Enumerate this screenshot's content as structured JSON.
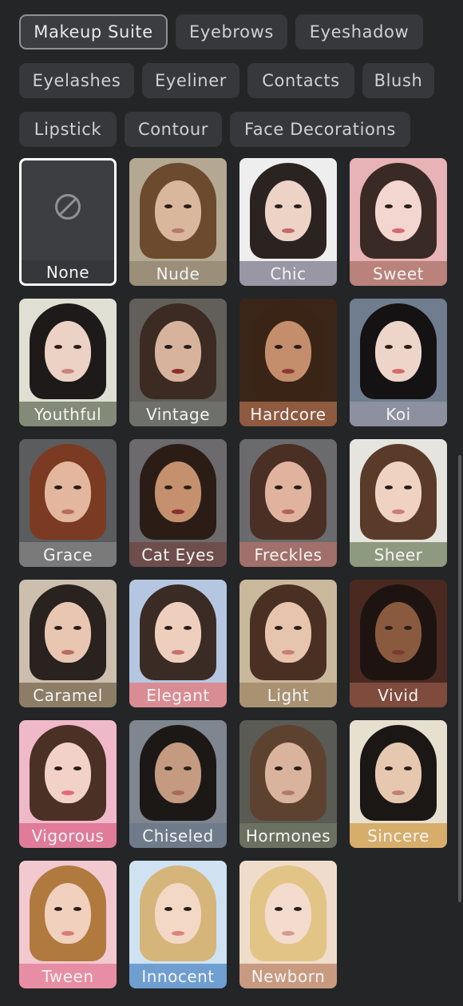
{
  "tabs": [
    [
      "Makeup Suite",
      "Eyebrows",
      "Eyeshadow"
    ],
    [
      "Eyelashes",
      "Eyeliner",
      "Contacts",
      "Blush"
    ],
    [
      "Lipstick",
      "Contour",
      "Face Decorations"
    ]
  ],
  "active_tab": "Makeup Suite",
  "styles": [
    {
      "label": "None",
      "selected": true
    },
    {
      "label": "Nude",
      "label_bg": "#9b8f7a",
      "bg": "#b5a892",
      "hair": "#6b4a2e",
      "skin": "#d9b79c",
      "lips": "#b9776e"
    },
    {
      "label": "Chic",
      "label_bg": "#9a97a5",
      "bg": "#eeeeee",
      "hair": "#2b2320",
      "skin": "#ecd3c6",
      "lips": "#c56a6a"
    },
    {
      "label": "Sweet",
      "label_bg": "#b9827a",
      "bg": "#e8b3b6",
      "hair": "#3a2a26",
      "skin": "#f2d6cf",
      "lips": "#d46a72"
    },
    {
      "label": "Youthful",
      "label_bg": "#838a78",
      "bg": "#dfe0d3",
      "hair": "#1e1a19",
      "skin": "#ecd2c4",
      "lips": "#c9837f"
    },
    {
      "label": "Vintage",
      "label_bg": "#6f6f6c",
      "bg": "#625f5b",
      "hair": "#3b2b22",
      "skin": "#d7b39d",
      "lips": "#8e2a2a"
    },
    {
      "label": "Hardcore",
      "label_bg": "#8e5a40",
      "bg": "#3b2519",
      "hair": "#3a2416",
      "skin": "#c48d6c",
      "lips": "#8e3a30"
    },
    {
      "label": "Koi",
      "label_bg": "#8c909f",
      "bg": "#6f7d8f",
      "hair": "#141212",
      "skin": "#eed5c9",
      "lips": "#d46a6a"
    },
    {
      "label": "Grace",
      "label_bg": "#7a7a7b",
      "bg": "#5a5c5e",
      "hair": "#7a3b22",
      "skin": "#e2b79d",
      "lips": "#b86a5e"
    },
    {
      "label": "Cat Eyes",
      "label_bg": "#6e4e4c",
      "bg": "#6d6a6d",
      "hair": "#2b1d16",
      "skin": "#c4906d",
      "lips": "#8c2f2f"
    },
    {
      "label": "Freckles",
      "label_bg": "#a1706a",
      "bg": "#6b6b6e",
      "hair": "#4a2f24",
      "skin": "#e0b39f",
      "lips": "#b5605a"
    },
    {
      "label": "Sheer",
      "label_bg": "#8e9a80",
      "bg": "#e6e4de",
      "hair": "#5a3b2a",
      "skin": "#efd2c2",
      "lips": "#d07b76"
    },
    {
      "label": "Caramel",
      "label_bg": "#8d7c66",
      "bg": "#cdbfae",
      "hair": "#2a221e",
      "skin": "#e8c6b2",
      "lips": "#b86d60"
    },
    {
      "label": "Elegant",
      "label_bg": "#d98c93",
      "bg": "#b5c6e0",
      "hair": "#3a2b24",
      "skin": "#eecfbe",
      "lips": "#c97070"
    },
    {
      "label": "Light",
      "label_bg": "#a89272",
      "bg": "#c9b89c",
      "hair": "#4a3022",
      "skin": "#e6c4ad",
      "lips": "#c48077"
    },
    {
      "label": "Vivid",
      "label_bg": "#7e4b3c",
      "bg": "#4a2a20",
      "hair": "#1d1412",
      "skin": "#8a5a3f",
      "lips": "#7a3a32"
    },
    {
      "label": "Vigorous",
      "label_bg": "#e07b9a",
      "bg": "#f0b9c9",
      "hair": "#4b3125",
      "skin": "#f2d2c6",
      "lips": "#e06b7d"
    },
    {
      "label": "Chiseled",
      "label_bg": "#6f7b8a",
      "bg": "#7f8690",
      "hair": "#1c1816",
      "skin": "#c49a80",
      "lips": "#a86a5e"
    },
    {
      "label": "Hormones",
      "label_bg": "#6b7060",
      "bg": "#5a5b55",
      "hair": "#5e4230",
      "skin": "#d9b39b",
      "lips": "#b07a6c"
    },
    {
      "label": "Sincere",
      "label_bg": "#d6ad6a",
      "bg": "#e8e0cf",
      "hair": "#1b1715",
      "skin": "#e6c7b0",
      "lips": "#c08373"
    },
    {
      "label": "Tween",
      "label_bg": "#e88ea4",
      "bg": "#f2c9cf",
      "hair": "#b07a3e",
      "skin": "#f1d0bd",
      "lips": "#d97a7d"
    },
    {
      "label": "Innocent",
      "label_bg": "#6f9fd0",
      "bg": "#cfe2f2",
      "hair": "#d6b57a",
      "skin": "#f4d8c6",
      "lips": "#d9837f"
    },
    {
      "label": "Newborn",
      "label_bg": "#c89a80",
      "bg": "#f0dccb",
      "hair": "#e2c487",
      "skin": "#f3dccd",
      "lips": "#d59a8f"
    }
  ],
  "icons": {
    "none": "prohibited-icon"
  }
}
